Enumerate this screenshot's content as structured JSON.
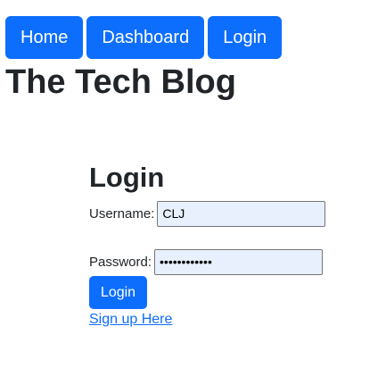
{
  "nav": {
    "items": [
      {
        "label": "Home"
      },
      {
        "label": "Dashboard"
      },
      {
        "label": "Login"
      }
    ]
  },
  "header": {
    "title": "The Tech Blog"
  },
  "login": {
    "title": "Login",
    "username_label": "Username:",
    "username_value": "CLJ",
    "password_label": "Password:",
    "password_value": "••••••••••••",
    "submit_label": "Login",
    "signup_link": "Sign up Here"
  },
  "colors": {
    "primary": "#0d6efd",
    "text": "#212529",
    "autofill_bg": "#e8f0fe"
  }
}
